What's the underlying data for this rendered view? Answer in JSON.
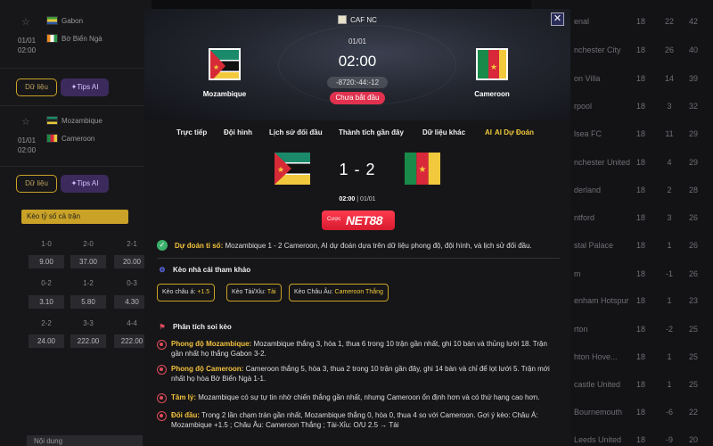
{
  "background": {
    "matches": [
      {
        "home": "Gabon",
        "away": "Bờ Biển Ngà",
        "date": "01/01",
        "time": "02:00"
      },
      {
        "home": "Mozambique",
        "away": "Cameroon",
        "date": "01/01",
        "time": "02:00"
      }
    ],
    "data_button": "Dữ liệu",
    "tips_button": "Tips AI",
    "odds_title": "Kèo tỷ số cả trận",
    "odds": [
      {
        "label": "1-0",
        "value": "9.00"
      },
      {
        "label": "2-0",
        "value": "37.00"
      },
      {
        "label": "2-1",
        "value": "20.00"
      },
      {
        "label": "0-2",
        "value": "3.10"
      },
      {
        "label": "1-2",
        "value": "5.80"
      },
      {
        "label": "0-3",
        "value": "4.30"
      },
      {
        "label": "2-2",
        "value": "24.00"
      },
      {
        "label": "3-3",
        "value": "222.00"
      },
      {
        "label": "4-4",
        "value": "222.00"
      }
    ],
    "content_select": "Nội dung",
    "standings": [
      {
        "team": "enal",
        "played": "18",
        "gd": "22",
        "points": "42"
      },
      {
        "team": "nchester City",
        "played": "18",
        "gd": "26",
        "points": "40"
      },
      {
        "team": "on Villa",
        "played": "18",
        "gd": "14",
        "points": "39"
      },
      {
        "team": "rpool",
        "played": "18",
        "gd": "3",
        "points": "32"
      },
      {
        "team": "lsea FC",
        "played": "18",
        "gd": "11",
        "points": "29"
      },
      {
        "team": "nchester United",
        "played": "18",
        "gd": "4",
        "points": "29"
      },
      {
        "team": "derland",
        "played": "18",
        "gd": "2",
        "points": "28"
      },
      {
        "team": "ntford",
        "played": "18",
        "gd": "3",
        "points": "26"
      },
      {
        "team": "stal Palace",
        "played": "18",
        "gd": "1",
        "points": "26"
      },
      {
        "team": "m",
        "played": "18",
        "gd": "-1",
        "points": "26"
      },
      {
        "team": "enham Hotspur",
        "played": "18",
        "gd": "1",
        "points": "23"
      },
      {
        "team": "rton",
        "played": "18",
        "gd": "-2",
        "points": "25"
      },
      {
        "team": "hton Hove...",
        "played": "18",
        "gd": "1",
        "points": "25"
      },
      {
        "team": "castle United",
        "played": "18",
        "gd": "1",
        "points": "25"
      },
      {
        "team": "Bournemouth",
        "played": "18",
        "gd": "-6",
        "points": "22"
      },
      {
        "team": "Leeds United",
        "played": "18",
        "gd": "-9",
        "points": "20"
      }
    ]
  },
  "modal": {
    "league": "CAF NC",
    "date": "01/01",
    "time": "02:00",
    "match_code": "-8720:-44:-12",
    "status": "Chưa bắt đầu",
    "home_team": "Mozambique",
    "away_team": "Cameroon",
    "tabs": [
      "Trực tiếp",
      "Đội hình",
      "Lịch sử đối đầu",
      "Thành tích gần đây",
      "Dữ liệu khác",
      "AI Dự Đoán"
    ],
    "ai_tab_icon": "AI",
    "score": "1 - 2",
    "score_time": "02:00",
    "score_date": "| 01/01",
    "bet_label_small": "Cược",
    "bet_brand": "NET88",
    "prediction_label": "Dự đoán tỉ số:",
    "prediction_text": "Mozambique 1 - 2 Cameroon, AI dự đoán dựa trên dữ liệu phong độ, đội hình, và lịch sử đối đầu.",
    "bookmaker_title": "Kèo nhà cái tham khảo",
    "bookmaker_pills": [
      {
        "label": "Kèo châu á:",
        "value": "+1.5"
      },
      {
        "label": "Kèo Tài/Xỉu:",
        "value": "Tài"
      },
      {
        "label": "Kèo Châu Âu:",
        "value": "Cameroon Thắng"
      }
    ],
    "analysis_title": "Phân tích soi kèo",
    "analysis": [
      {
        "label": "Phong độ Mozambique:",
        "text": "Mozambique thắng 3, hòa 1, thua 6 trong 10 trận gần nhất, ghi 10 bàn và thủng lưới 18. Trận gần nhất họ thắng Gabon 3-2."
      },
      {
        "label": "Phong độ Cameroon:",
        "text": "Cameroon thắng 5, hòa 3, thua 2 trong 10 trận gần đây, ghi 14 bàn và chỉ để lọt lưới 5. Trận mới nhất họ hòa Bờ Biển Ngà 1-1."
      },
      {
        "label": "Tâm lý:",
        "text": "Mozambique có sự tự tin nhờ chiến thắng gần nhất, nhưng Cameroon ổn định hơn và có thứ hạng cao hơn."
      },
      {
        "label": "Đối đầu:",
        "text": "Trong 2 lần chạm trán gần nhất, Mozambique thắng 0, hòa 0, thua 4 so với Cameroon. Gợi ý kèo: Châu Á: Mozambique +1.5 ; Châu Âu: Cameroon Thắng ; Tài-Xỉu: O/U 2.5 → Tài"
      }
    ],
    "colors": {
      "accent": "#f0c93a",
      "status": "#e0324f",
      "brand": "#e4203a"
    }
  }
}
